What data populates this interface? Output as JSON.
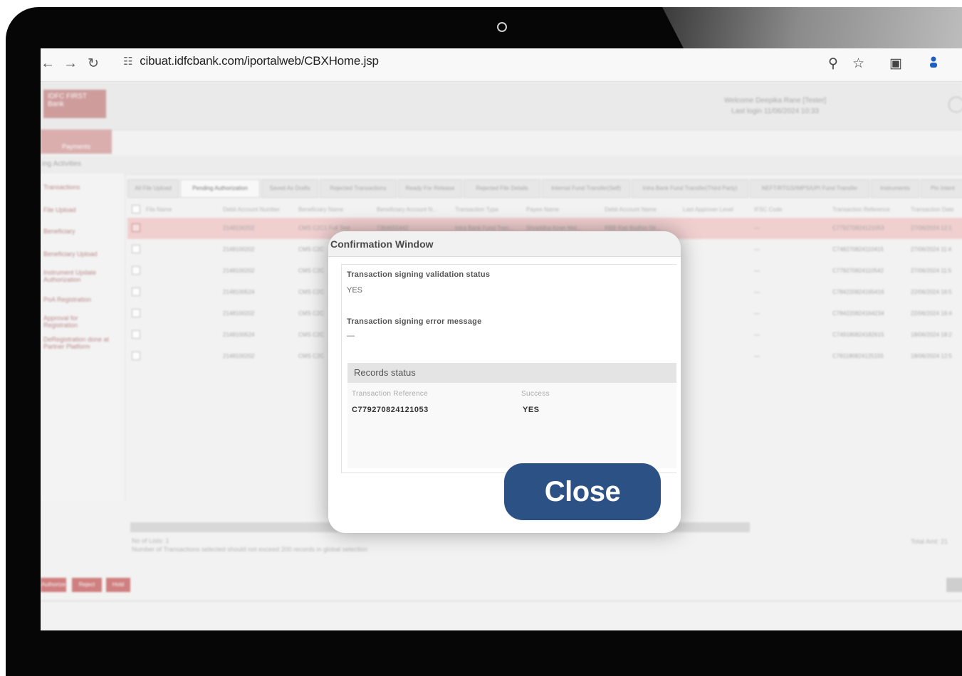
{
  "browser": {
    "url": "cibuat.idfcbank.com/iportalweb/CBXHome.jsp"
  },
  "app": {
    "logo_text": "IDFC FIRST Bank",
    "welcome_line1": "Welcome Deepika Rane [Tester]",
    "welcome_line2": "Last login 11/06/2024 10:33",
    "top_tab": "Payments",
    "pending_label": "ing Activities",
    "sidebar": [
      {
        "label": "Transactions"
      },
      {
        "label": "File Upload"
      },
      {
        "label": "Beneficiary"
      },
      {
        "label": "Beneficiary Upload"
      },
      {
        "label": "Instrument Update Authorization"
      },
      {
        "label": "PoA Registration"
      },
      {
        "label": "Approval for Registration"
      },
      {
        "label": "DeRegistration done at Partner Platform"
      }
    ],
    "tabs": [
      {
        "label": "All File Upload"
      },
      {
        "label": "Pending Authorization"
      },
      {
        "label": "Saved As Drafts"
      },
      {
        "label": "Rejected Transactions"
      },
      {
        "label": "Ready For Release"
      },
      {
        "label": "Rejected File Details"
      },
      {
        "label": "Internal Fund Transfer(Self)"
      },
      {
        "label": "Intra Bank Fund Transfer(Third Party)"
      },
      {
        "label": "NEFT/RTGS/IMPS/UPI Fund Transfer"
      },
      {
        "label": "Instruments"
      },
      {
        "label": "Pin Intent"
      }
    ],
    "columns": [
      "File Name",
      "Debit Account Number",
      "Beneficiary Name",
      "Beneficiary Account N...",
      "Transaction Type",
      "Payee Name",
      "Debit Account Name",
      "Last Approver Level",
      "IFSC Code",
      "Transaction Reference",
      "Transaction Date"
    ],
    "rows": [
      {
        "acct": "2148100202",
        "bene": "CMS C2C1 Full Test",
        "ref": "C779270824121053",
        "date": "27/06/2024 12:1"
      },
      {
        "acct": "2148100202",
        "bene": "CMS C2C",
        "ref": "C748270824110415",
        "date": "27/06/2024 11:4"
      },
      {
        "acct": "2148100202",
        "bene": "CMS C2C",
        "ref": "C779270824110542",
        "date": "27/06/2024 11:5"
      },
      {
        "acct": "2148100524",
        "bene": "CMS C2C",
        "ref": "C784220824165416",
        "date": "22/06/2024 16:5"
      },
      {
        "acct": "2148100202",
        "bene": "CMS C2C",
        "ref": "C784220824164234",
        "date": "22/06/2024 16:4"
      },
      {
        "acct": "2148100524",
        "bene": "CMS C2C",
        "ref": "C749180824182615",
        "date": "18/06/2024 18:2"
      },
      {
        "acct": "2148100202",
        "bene": "CMS C2C",
        "ref": "C781180824125155",
        "date": "18/06/2024 12:5"
      }
    ],
    "selected_row_extra": [
      "7364655442",
      "Intra Bank Fund Tran...",
      "Shraddha Kiran Mal...",
      "RBB Rati Bodhio Str...",
      "—"
    ],
    "footer_line1": "No of Lists: 1",
    "footer_line2": "Number of Transactions selected should not exceed 200 records in global selection",
    "total_amount": "Total Amt: 21",
    "actions": [
      "Authorize",
      "Reject",
      "Hold"
    ]
  },
  "modal": {
    "title": "Confirmation Window",
    "validation_label": "Transaction signing validation status",
    "validation_value": "YES",
    "error_label": "Transaction signing error message",
    "error_value": "—",
    "records_status_title": "Records status",
    "col_reference": "Transaction Reference",
    "col_success": "Success",
    "row_reference": "C779270824121053",
    "row_success": "YES",
    "close_label": "Close"
  },
  "colors": {
    "close_button": "#2c5285",
    "accent_red": "#c96b6b"
  }
}
